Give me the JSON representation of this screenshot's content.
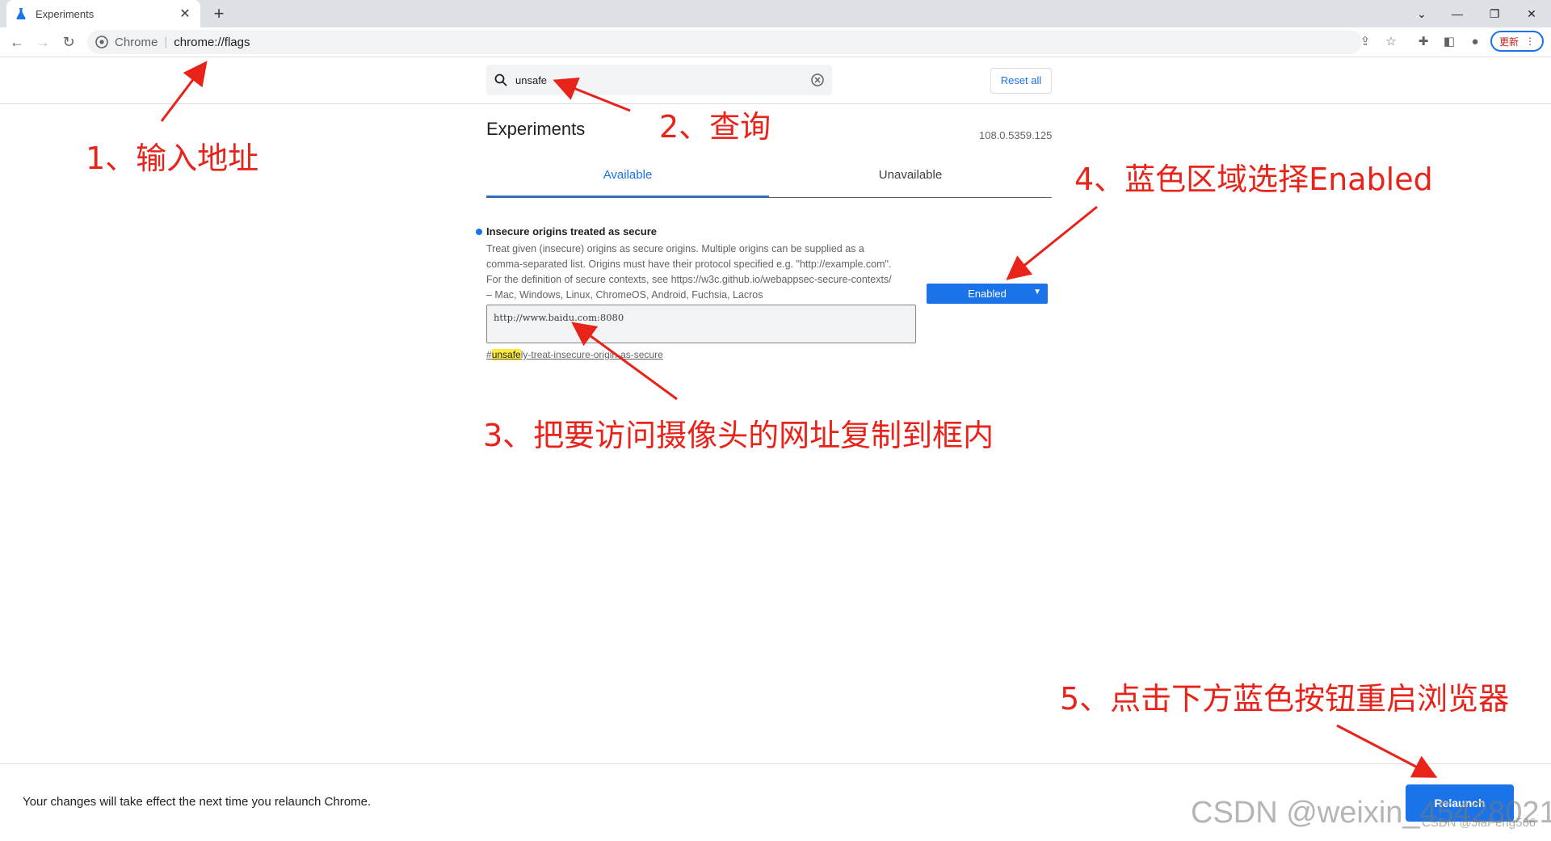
{
  "browser": {
    "tab_title": "Experiments",
    "site_label": "Chrome",
    "url": "chrome://flags",
    "update_label": "更新"
  },
  "flags": {
    "search_value": "unsafe",
    "reset_label": "Reset all",
    "page_title": "Experiments",
    "version": "108.0.5359.125",
    "tabs": [
      "Available",
      "Unavailable"
    ],
    "experiment": {
      "name": "Insecure origins treated as secure",
      "description_lines": [
        "Treat given (insecure) origins as secure origins. Multiple origins can be supplied as a",
        "comma-separated list. Origins must have their protocol specified e.g. \"http://example.com\".",
        "For the definition of secure contexts, see https://w3c.github.io/webappsec-secure-contexts/",
        "– Mac, Windows, Linux, ChromeOS, Android, Fuchsia, Lacros"
      ],
      "origins_value": "http://www.baidu.com:8080",
      "link_prefix": "#",
      "link_highlight": "unsafe",
      "link_rest": "ly-treat-insecure-origin-as-secure",
      "state": "Enabled"
    },
    "bottom_message": "Your changes will take effect the next time you relaunch Chrome.",
    "relaunch_label": "Relaunch"
  },
  "annotations": {
    "step1": "1、输入地址",
    "step2": "2、查询",
    "step3": "3、把要访问摄像头的网址复制到框内",
    "step4": "4、蓝色区域选择Enabled",
    "step5": "5、点击下方蓝色按钮重启浏览器",
    "watermark": "CSDN @weixin_45428021",
    "watermark2": "CSDN @JiaPeng566"
  },
  "colors": {
    "accent": "#1a73e8",
    "annotation": "#e8231a",
    "highlight": "#ffeb3b"
  }
}
